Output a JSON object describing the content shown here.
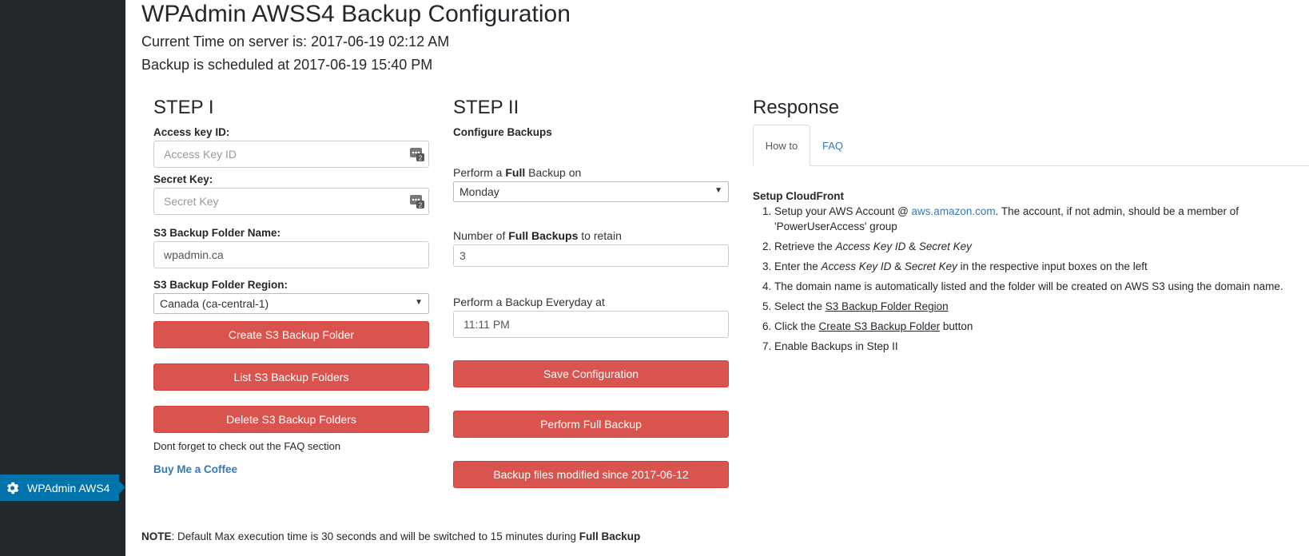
{
  "sidebar": {
    "active_item": "WPAdmin AWS4",
    "active_icon": "gear-icon"
  },
  "header": {
    "title": "WPAdmin AWSS4 Backup Configuration",
    "server_time": "Current Time on server is: 2017-06-19 02:12 AM",
    "schedule": "Backup is scheduled at 2017-06-19 15:40 PM"
  },
  "step1": {
    "heading": "STEP I",
    "access_key_label": "Access key ID:",
    "access_key_placeholder": "Access Key ID",
    "secret_key_label": "Secret Key:",
    "secret_key_placeholder": "Secret Key",
    "folder_name_label": "S3 Backup Folder Name:",
    "folder_name_value": "wpadmin.ca",
    "region_label": "S3 Backup Folder Region:",
    "region_value": "Canada (ca-central-1)",
    "create_button": "Create S3 Backup Folder",
    "list_button": "List S3 Backup Folders",
    "delete_button": "Delete S3 Backup Folders",
    "faq_hint": "Dont forget to check out the FAQ section",
    "coffee_link": "Buy Me a Coffee"
  },
  "step2": {
    "heading": "STEP II",
    "subheading": "Configure Backups",
    "full_backup_day_label_pre": "Perform a ",
    "full_backup_day_label_bold": "Full",
    "full_backup_day_label_post": " Backup on",
    "full_backup_day_value": "Monday",
    "retain_label_pre": "Number of ",
    "retain_label_bold": "Full Backups",
    "retain_label_post": " to retain",
    "retain_value": "3",
    "daily_label": "Perform a Backup Everyday at",
    "daily_value": "11:11 PM",
    "save_button": "Save Configuration",
    "full_backup_button": "Perform Full Backup",
    "incremental_button": "Backup files modified since 2017-06-12"
  },
  "response": {
    "heading": "Response",
    "tabs": [
      "How to",
      "FAQ"
    ],
    "howto_title": "Setup CloudFront",
    "steps": {
      "s1_pre": "Setup your AWS Account @ ",
      "s1_link": "aws.amazon.com",
      "s1_post": ". The account, if not admin, should be a member of 'PowerUserAccess' group",
      "s2_pre": "Retrieve the ",
      "s2_em1": "Access Key ID",
      "s2_mid": " & ",
      "s2_em2": "Secret Key",
      "s3_pre": "Enter the ",
      "s3_em1": "Access Key ID",
      "s3_mid": " & ",
      "s3_em2": "Secret Key",
      "s3_post": " in the respective input boxes on the left",
      "s4": "The domain name is automatically listed and the folder will be created on AWS S3 using the domain name.",
      "s5_pre": "Select the ",
      "s5_u": "S3 Backup Folder Region",
      "s6_pre": "Click the ",
      "s6_u": "Create S3 Backup Folder",
      "s6_post": " button",
      "s7": "Enable Backups in Step II"
    }
  },
  "note": {
    "label": "NOTE",
    "text": ": Default Max execution time is 30 seconds and will be switched to 15 minutes during ",
    "bold_end": "Full Backup"
  },
  "colors": {
    "sidebar_bg": "#23282d",
    "active_blue": "#0073aa",
    "danger_red": "#d9534f",
    "link_blue": "#337ab7"
  }
}
